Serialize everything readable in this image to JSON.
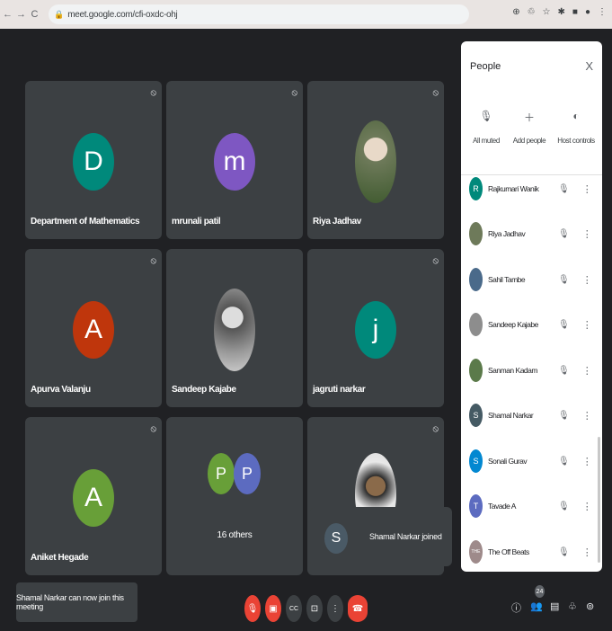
{
  "browser": {
    "url": "meet.google.com/cfi-oxdc-ohj",
    "nav": [
      "←",
      "→",
      "C"
    ],
    "icons": [
      "⊕",
      "♲",
      "☆",
      "✱",
      "■",
      "●",
      "⋮"
    ]
  },
  "tiles": [
    {
      "name": "Department of Mathematics",
      "initial": "D",
      "color": "#00897b",
      "type": "letter"
    },
    {
      "name": "mrunali patil",
      "initial": "m",
      "color": "#7e57c2",
      "type": "letter"
    },
    {
      "name": "Riya Jadhav",
      "type": "photo",
      "color": "#6e7a5a"
    },
    {
      "name": "Apurva Valanju",
      "initial": "A",
      "color": "#bf360c",
      "type": "letter"
    },
    {
      "name": "Sandeep Kajabe",
      "type": "photo",
      "color": "#8d8d8d"
    },
    {
      "name": "jagruti narkar",
      "initial": "j",
      "color": "#00897b",
      "type": "letter"
    },
    {
      "name": "Aniket Hegade",
      "initial": "A",
      "color": "#689f38",
      "type": "letter"
    },
    {
      "name": "",
      "others_label": "16 others",
      "p1": "P",
      "p2": "P",
      "p1_color": "#689f38",
      "p2_color": "#5c6bc0",
      "type": "group"
    },
    {
      "name": "",
      "type": "photo",
      "color": "#d6d6d6"
    }
  ],
  "toast": {
    "initial": "S",
    "text": "Shamal Narkar joined"
  },
  "snackbar": {
    "text": "Shamal Narkar can now join this meeting"
  },
  "people_panel": {
    "title": "People",
    "close": "X",
    "actions": [
      {
        "icon": "mic-off-icon",
        "glyph": "🎙",
        "label": "All muted"
      },
      {
        "icon": "add-person-icon",
        "glyph": "＋",
        "label": "Add people"
      },
      {
        "icon": "host-controls-icon",
        "glyph": "◐",
        "label": "Host controls"
      }
    ],
    "participants": [
      {
        "name": "Rajkumari Wanik",
        "initial": "R",
        "color": "#00897b"
      },
      {
        "name": "Riya Jadhav",
        "initial": "",
        "color": "#6e7a5a"
      },
      {
        "name": "Sahil Tambe",
        "initial": "",
        "color": "#4a6a8a"
      },
      {
        "name": "Sandeep Kajabe",
        "initial": "",
        "color": "#8d8d8d"
      },
      {
        "name": "Sanman Kadam",
        "initial": "",
        "color": "#5b7a4a"
      },
      {
        "name": "Shamal Narkar",
        "initial": "S",
        "color": "#455a64"
      },
      {
        "name": "Sonali Gurav",
        "initial": "S",
        "color": "#0288d1"
      },
      {
        "name": "Tavade A",
        "initial": "T",
        "color": "#5c6bc0"
      },
      {
        "name": "The Off Beats",
        "initial": "THE",
        "color": "#9e8a8a"
      }
    ],
    "mic_glyph": "🎙",
    "more_glyph": "⋮"
  },
  "controls": {
    "mic_glyph": "🎙",
    "cam_glyph": "▣",
    "cc_glyph": "CC",
    "present_glyph": "⊡",
    "more_glyph": "⋮",
    "hangup_glyph": "☎"
  },
  "bottom_right": {
    "info_glyph": "ⓘ",
    "people_glyph": "👥",
    "people_count": "24",
    "chat_glyph": "▤",
    "activities_glyph": "♧",
    "lock_glyph": "⊚"
  }
}
